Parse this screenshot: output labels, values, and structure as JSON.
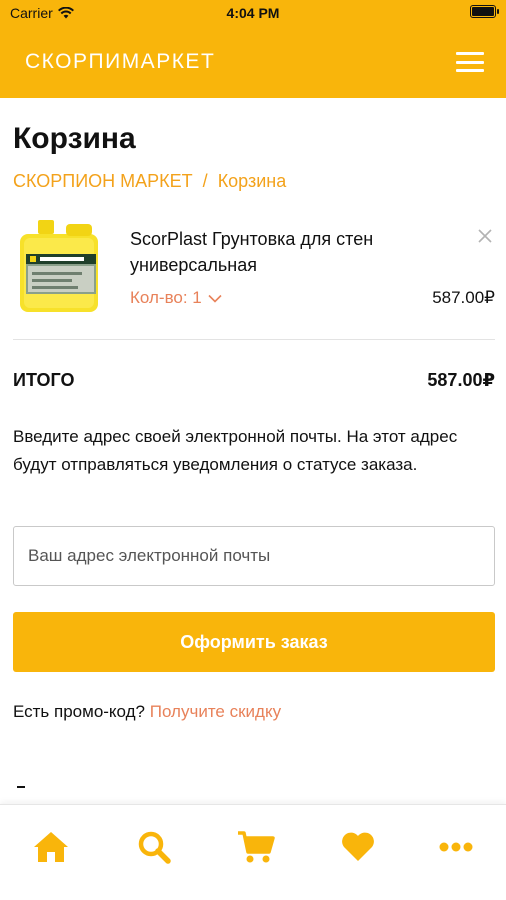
{
  "status_bar": {
    "carrier": "Carrier",
    "time": "4:04 PM"
  },
  "app_bar": {
    "brand": "СКОРПИМАРКЕТ",
    "menu_icon": "hamburger-menu-icon"
  },
  "page": {
    "title": "Корзина",
    "breadcrumb": {
      "home": "СКОРПИОН МАРКЕТ",
      "separator": "/",
      "current": "Корзина"
    }
  },
  "cart": {
    "items": [
      {
        "name": "ScorPlast Грунтовка для стен универсальная",
        "quantity_label": "Кол-во: 1",
        "price": "587.00₽",
        "image_icon": "primer-canister-image"
      }
    ],
    "total_label": "ИТОГО",
    "total_value": "587.00₽"
  },
  "email": {
    "note": "Введите адрес своей электронной почты. На этот адрес будут отправляться уведомления о статусе заказа.",
    "placeholder": "Ваш адрес электронной почты",
    "value": ""
  },
  "checkout": {
    "button_label": "Оформить заказ"
  },
  "promo": {
    "question": "Есть промо-код?",
    "link": "Получите скидку"
  },
  "tabbar": {
    "tabs": [
      {
        "icon": "home-icon"
      },
      {
        "icon": "search-icon"
      },
      {
        "icon": "cart-icon"
      },
      {
        "icon": "heart-icon"
      },
      {
        "icon": "more-icon"
      }
    ]
  },
  "colors": {
    "accent": "#f9b50b",
    "link": "#f3a21b",
    "secondary_link": "#e8825a"
  }
}
